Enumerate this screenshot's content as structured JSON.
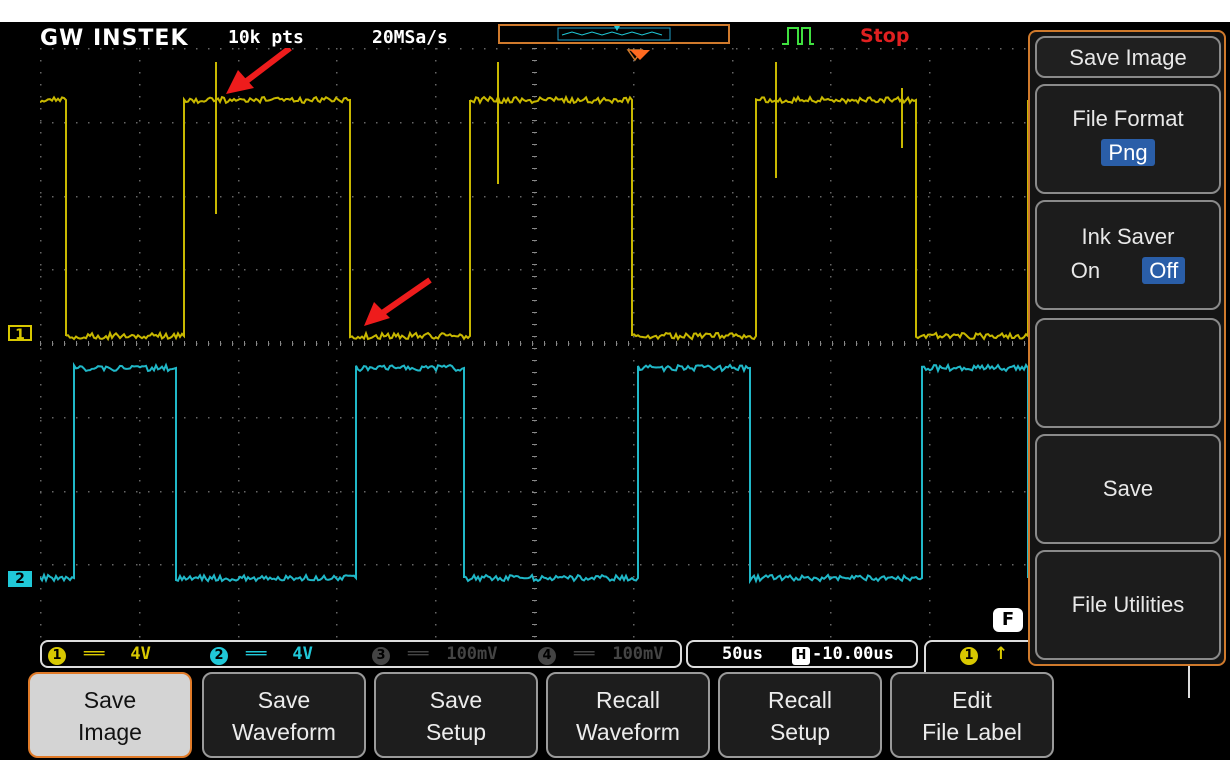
{
  "topbar": {
    "brand": "GW INSTEK",
    "points": "10k pts",
    "sample_rate": "20MSa/s",
    "run_state": "Stop"
  },
  "channels": {
    "ch1_marker": "1",
    "ch2_marker": "2",
    "ch1_color": "#d8c800",
    "ch2_color": "#20c8d8"
  },
  "infobar": {
    "ch1_num": "1",
    "ch1_coupling": "══",
    "ch1_scale": "4V",
    "ch2_num": "2",
    "ch2_coupling": "══",
    "ch2_scale": "4V",
    "ch3_num": "3",
    "ch3_coupling": "══",
    "ch3_scale": "100mV",
    "ch4_num": "4",
    "ch4_coupling": "══",
    "ch4_scale": "100mV",
    "timebase": "50us",
    "h_position": "-10.00us",
    "trig_source": "1",
    "f_label": "F"
  },
  "side_menu": {
    "title": "Save Image",
    "file_format_label": "File Format",
    "file_format_value": "Png",
    "ink_saver_label": "Ink Saver",
    "ink_saver_on": "On",
    "ink_saver_off": "Off",
    "save_label": "Save",
    "file_utilities_label": "File Utilities"
  },
  "bottom_menu": [
    {
      "line1": "Save",
      "line2": "Image"
    },
    {
      "line1": "Save",
      "line2": "Waveform"
    },
    {
      "line1": "Save",
      "line2": "Setup"
    },
    {
      "line1": "Recall",
      "line2": "Waveform"
    },
    {
      "line1": "Recall",
      "line2": "Setup"
    },
    {
      "line1": "Edit",
      "line2": "File Label"
    }
  ]
}
